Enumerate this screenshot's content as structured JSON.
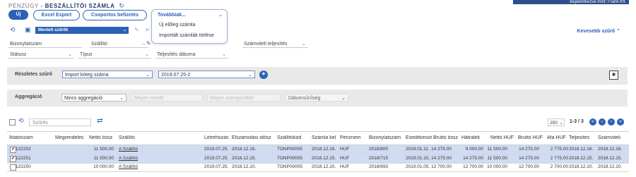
{
  "header": {
    "breadcrumb_module": "PÉNZÜGY",
    "breadcrumb_sep": "›",
    "breadcrumb_page": "BESZÁLLÍTÓI SZÁMLA",
    "user_text": "Bejelentkezve mint: Frank Kft."
  },
  "toolbar": {
    "new_label": "Új",
    "excel_label": "Excel Export",
    "bulk_pay_label": "Csoportos befizetés",
    "more_label": "Továbbiak...",
    "more_items": [
      "Új előleg számla",
      "Importált számlák törlése"
    ]
  },
  "saved_filters": {
    "label": "Mentett szűrők",
    "less_filter": "Kevesebb szűrő"
  },
  "filters": {
    "invoice_no": "Bizonylatszám",
    "supplier": "Szállító",
    "supplier_dots": "...",
    "accounting_done": "Számviteli teljesítés",
    "status": "Státusz",
    "type": "Típus",
    "fulfilment_date": "Teljesítés dátuma"
  },
  "detailed_filter": {
    "label": "Részletes szűrő",
    "field": "Import köteg száma",
    "value": "2019.07.25-2"
  },
  "aggregation": {
    "label": "Aggregáció",
    "value": "Nincs aggregáció",
    "measure_placeholder": "Milyen mezőt",
    "aspect_placeholder": "Milyen szempontból",
    "date_density": "Dátumsűrűség"
  },
  "list_toolbar": {
    "search_placeholder": "Szűrés",
    "page_size": "250",
    "range": "1-3",
    "of": "/ 3"
  },
  "columns": [
    "Iktatószám",
    "Megrendelés",
    "Nettó össz",
    "Szállító",
    "Létrehozás",
    "Elszámolási idősz",
    "Szállítókód",
    "Számla kel",
    "Pénznem",
    "Bizonylatszám",
    "Esedékesség",
    "Bruttó össz",
    "Hátralék",
    "Nettó HUF",
    "Bruttó HUF",
    "Áfa HUF",
    "Teljesítés",
    "Számviteli"
  ],
  "rows": [
    {
      "selected": true,
      "cells": [
        "122252",
        "",
        "11 500.00",
        "A Szállító",
        "2019.07.25.",
        "2018.12.16.",
        "TONP00005",
        "2018.12.16.",
        "HUF",
        "2018/800",
        "2019.01.11.",
        "14 275.00",
        "9 000.00",
        "11 500.00",
        "14 275.00",
        "2 775.00",
        "2018.12.16.",
        "2018.12.16."
      ]
    },
    {
      "selected": true,
      "cells": [
        "122251",
        "",
        "11 500.00",
        "A Szállító",
        "2019.07.25.",
        "2018.12.15.",
        "TONP00005",
        "2018.12.15.",
        "HUF",
        "2018/715",
        "2019.01.10.",
        "14 275.00",
        "14 275.00",
        "11 500.00",
        "14 275.00",
        "2 775.00",
        "2018.12.15.",
        "2018.12.15."
      ]
    },
    {
      "selected": false,
      "cells": [
        "122250",
        "",
        "10 000.00",
        "A Szállító",
        "2019.07.25.",
        "2018.12.10.",
        "TONP00005",
        "2018.12.10.",
        "HUF",
        "2018/693",
        "2019.01.05.",
        "12 700.00",
        "12 700.00",
        "10 000.00",
        "12 700.00",
        "2 700.00",
        "2018.12.10.",
        "2018.12.10."
      ]
    }
  ],
  "colors": {
    "accent": "#2b61b6",
    "selected_row": "#cfdcf3",
    "panel": "#e9e9e9"
  }
}
